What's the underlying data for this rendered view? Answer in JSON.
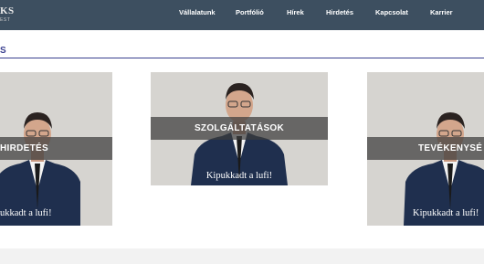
{
  "header": {
    "logo_text": "KS",
    "logo_subtext": "EST",
    "nav": [
      "Vállalatunk",
      "Portfólió",
      "Hírek",
      "Hirdetés",
      "Kapcsolat",
      "Karrier"
    ]
  },
  "section": {
    "title": "S"
  },
  "cards": [
    {
      "overlay_title": "HIRDETÉS",
      "caption": "ukkadt a lufi!"
    },
    {
      "overlay_title": "SZOLGÁLTATÁSOK",
      "caption": "Kipukkadt a lufi!"
    },
    {
      "overlay_title": "TEVÉKENYSÉ",
      "caption": "Kipukkadt a lufi!"
    }
  ],
  "colors": {
    "header_bg": "#3d4f60",
    "accent": "#3a3f8f"
  }
}
